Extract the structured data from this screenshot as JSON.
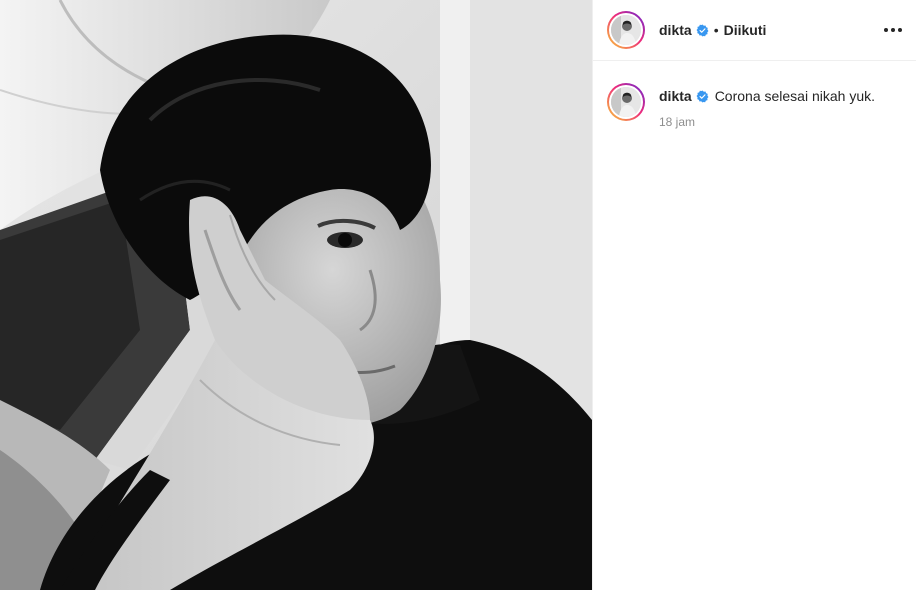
{
  "post": {
    "author": {
      "username": "dikta",
      "verified": true,
      "follow_separator": "•",
      "follow_status": "Diikuti"
    },
    "caption": {
      "username": "dikta",
      "text": "Corona selesai nikah yuk.",
      "timestamp": "18 jam"
    },
    "photo": {
      "description_icon": "black-and-white-selfie"
    }
  },
  "colors": {
    "username": "#262626",
    "timestamp": "#8e8e8e",
    "verified_badge": "#3897f0",
    "story_ring": [
      "#f9ce34",
      "#ee2a7b",
      "#6228d7"
    ]
  }
}
